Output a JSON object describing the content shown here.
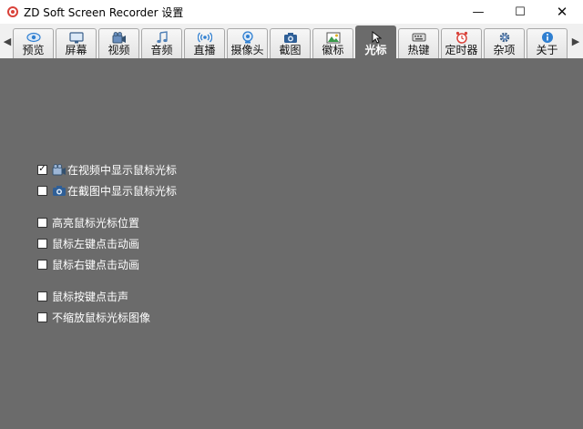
{
  "window": {
    "title": "ZD Soft Screen Recorder 设置",
    "controls": {
      "minimize": "—",
      "maximize": "☐",
      "close": "✕"
    }
  },
  "tabs": [
    {
      "label": "预览",
      "icon": "eye-icon",
      "active": false
    },
    {
      "label": "屏幕",
      "icon": "monitor-icon",
      "active": false
    },
    {
      "label": "视频",
      "icon": "video-camera-icon",
      "active": false
    },
    {
      "label": "音频",
      "icon": "music-note-icon",
      "active": false
    },
    {
      "label": "直播",
      "icon": "broadcast-icon",
      "active": false
    },
    {
      "label": "摄像头",
      "icon": "webcam-icon",
      "active": false
    },
    {
      "label": "截图",
      "icon": "camera-icon",
      "active": false
    },
    {
      "label": "徽标",
      "icon": "picture-icon",
      "active": false
    },
    {
      "label": "光标",
      "icon": "cursor-icon",
      "active": true
    },
    {
      "label": "热键",
      "icon": "keyboard-icon",
      "active": false
    },
    {
      "label": "定时器",
      "icon": "alarm-clock-icon",
      "active": false
    },
    {
      "label": "杂项",
      "icon": "gear-icon",
      "active": false
    },
    {
      "label": "关于",
      "icon": "info-icon",
      "active": false
    }
  ],
  "options": [
    {
      "label": "在视频中显示鼠标光标",
      "checked": true,
      "icon": "video-camera-icon"
    },
    {
      "label": "在截图中显示鼠标光标",
      "checked": false,
      "icon": "camera-icon"
    },
    {
      "label": "高亮鼠标光标位置",
      "checked": false
    },
    {
      "label": "鼠标左键点击动画",
      "checked": false
    },
    {
      "label": "鼠标右键点击动画",
      "checked": false
    },
    {
      "label": "鼠标按键点击声",
      "checked": false
    },
    {
      "label": "不缩放鼠标光标图像",
      "checked": false
    }
  ],
  "colors": {
    "panel_bg": "#6b6b6b",
    "accent_blue": "#2f7fd1",
    "app_icon_red": "#d9423a"
  }
}
